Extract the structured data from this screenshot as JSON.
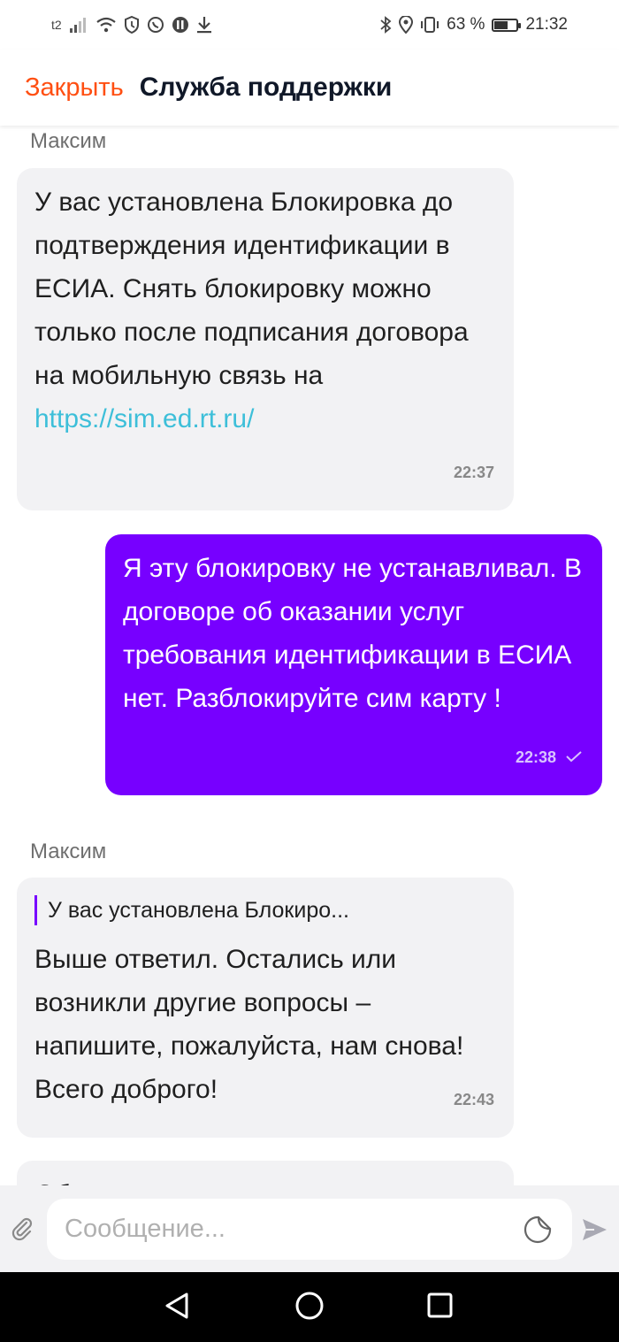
{
  "status_bar": {
    "carrier": "t2",
    "battery_percent": "63 %",
    "battery_level": 0.63,
    "time": "21:32",
    "icons": [
      "signal-icon",
      "wifi-icon",
      "shield-icon",
      "whatsapp-icon",
      "vpn-icon",
      "download-icon",
      "bluetooth-icon",
      "location-icon",
      "vibrate-icon",
      "battery-icon"
    ]
  },
  "header": {
    "close_label": "Закрыть",
    "title": "Служба поддержки"
  },
  "messages": [
    {
      "sender": "Максим",
      "text": "У вас установлена Блокировка до подтверждения идентификации в ЕСИА. Снять блокировку можно только после подписания договора на мобильную связь на",
      "link": "https://sim.ed.rt.ru/",
      "time": "22:37"
    },
    {
      "text": "Я эту блокировку не устанавливал. В договоре об оказании услуг требования идентификации в ЕСИА нет. Разблокируйте сим карту !",
      "time": "22:38",
      "status": "sent-check-icon"
    },
    {
      "sender": "Максим",
      "quote": "У вас установлена Блокиро...",
      "text": "Выше ответил. Остались или возникли другие вопросы – напишите, пожалуйста, нам снова! Всего доброго!",
      "time": "22:43"
    },
    {
      "text": "Об"
    }
  ],
  "composer": {
    "placeholder": "Сообщение..."
  },
  "colors": {
    "accent": "#ff4f12",
    "outgoing_bubble": "#7700ff",
    "incoming_bubble": "#f2f2f4",
    "link": "#3dbfd9"
  }
}
